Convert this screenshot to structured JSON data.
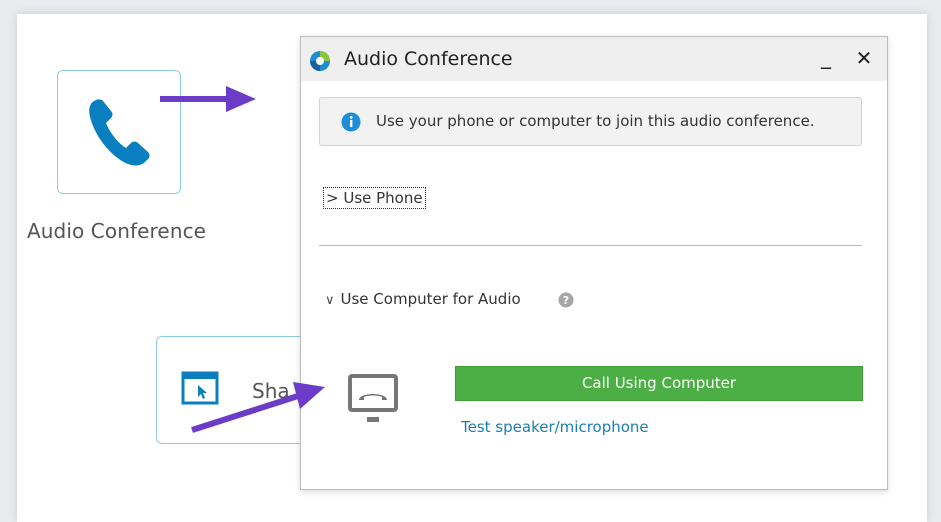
{
  "background": {
    "audio_tile_label": "Audio Conference",
    "share_tile_label": "Sha"
  },
  "dialog": {
    "title": "Audio Conference",
    "minimize_label": "_",
    "close_label": "✕",
    "info_text": "Use your phone or computer to join this audio conference.",
    "use_phone_label": "> Use Phone",
    "use_computer_label": "Use Computer for Audio",
    "call_button_label": "Call Using Computer",
    "test_link_label": "Test speaker/microphone"
  },
  "colors": {
    "accent_blue": "#0a7fbf",
    "call_green": "#4caf45",
    "arrow_purple": "#6a3cc8",
    "link_blue": "#1a7fb4"
  },
  "icons": {
    "audio_tile": "phone-icon",
    "share_tile": "share-screen-icon",
    "app_logo": "webex-logo-icon",
    "info": "info-icon",
    "help": "help-icon",
    "desk_phone": "desk-phone-icon"
  }
}
